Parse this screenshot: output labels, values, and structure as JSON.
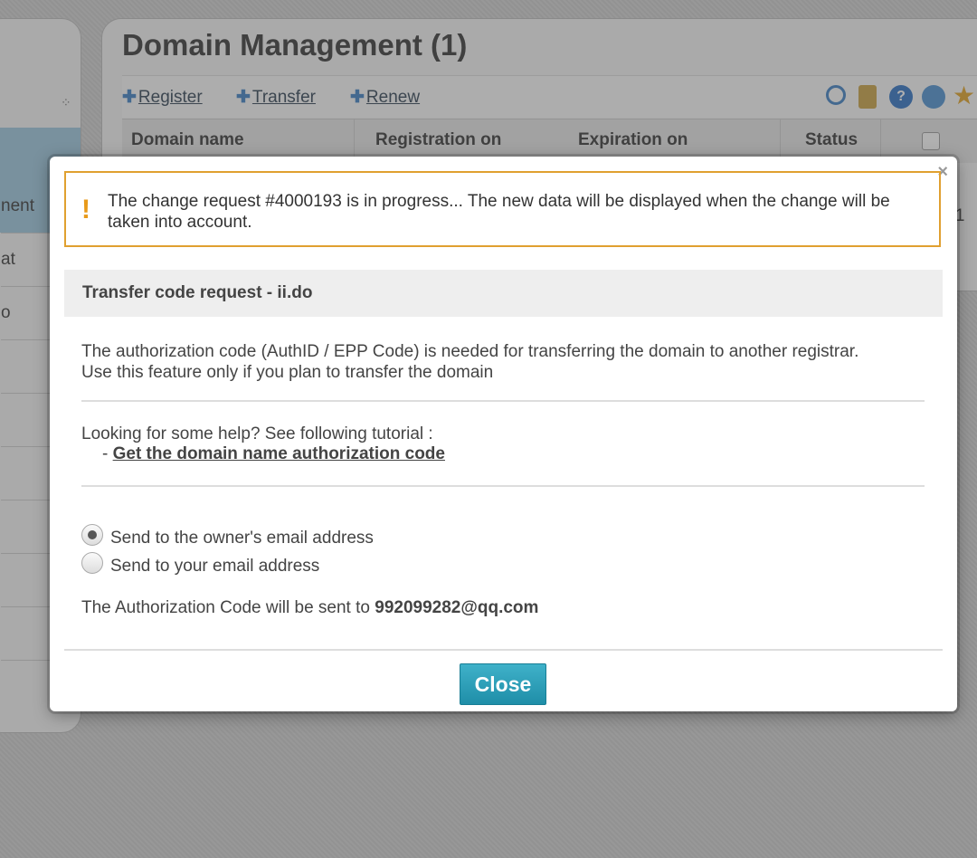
{
  "background": {
    "page_title": "Domain Management (1)",
    "left_menu": [
      "nent",
      "at",
      "o"
    ],
    "toolbar": {
      "register_label": "Register",
      "transfer_label": "Transfer",
      "renew_label": "Renew",
      "icons": [
        "magnifier-icon",
        "hourglass-icon",
        "help-icon",
        "gear-icon",
        "star-icon"
      ]
    },
    "table_headers": [
      "Domain name",
      "Registration on",
      "Expiration on",
      "Status"
    ],
    "row_peek": "n 1"
  },
  "modal": {
    "close_symbol": "×",
    "alert": {
      "icon": "!",
      "text": "The change request #4000193 is in progress... The new data will be displayed when the change will be taken into account."
    },
    "section_title": "Transfer code request - ii.do",
    "description_line1": "The authorization code (AuthID / EPP Code) is needed for transferring the domain to another registrar.",
    "description_line2": "Use this feature only if you plan to transfer the domain",
    "help_text": "Looking for some help? See following tutorial :",
    "help_prefix": "-",
    "help_link": "Get the domain name authorization code",
    "radio_options": [
      {
        "label": "Send to the owner's email address",
        "checked": true
      },
      {
        "label": "Send to your email address",
        "checked": false
      }
    ],
    "send_to_prefix": "The Authorization Code will be sent to",
    "send_to_email": "992099282@qq.com",
    "close_button": "Close"
  },
  "colors": {
    "alert_border": "#e0a030",
    "alert_icon": "#e89a1a",
    "button": "#2a9fb8",
    "active_menu": "#9cc6de"
  }
}
